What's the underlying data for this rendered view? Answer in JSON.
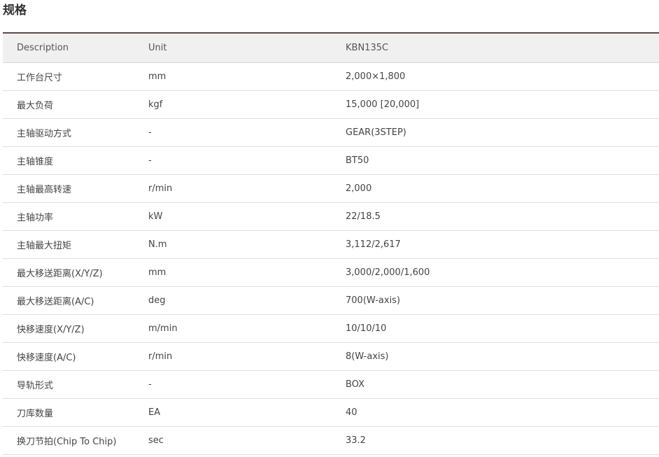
{
  "title": "规格",
  "table": {
    "headers": [
      "Description",
      "Unit",
      "KBN135C"
    ],
    "rows": [
      [
        "工作台尺寸",
        "mm",
        "2,000×1,800"
      ],
      [
        "最大负荷",
        "kgf",
        "15,000 [20,000]"
      ],
      [
        "主轴驱动方式",
        "-",
        "GEAR(3STEP)"
      ],
      [
        "主轴锥度",
        "-",
        "BT50"
      ],
      [
        "主轴最高转速",
        "r/min",
        "2,000"
      ],
      [
        "主轴功率",
        "kW",
        "22/18.5"
      ],
      [
        "主轴最大扭矩",
        "N.m",
        "3,112/2,617"
      ],
      [
        "最大移送距离(X/Y/Z)",
        "mm",
        "3,000/2,000/1,600"
      ],
      [
        "最大移送距离(A/C)",
        "deg",
        "700(W-axis)"
      ],
      [
        "快移速度(X/Y/Z)",
        "m/min",
        "10/10/10"
      ],
      [
        "快移速度(A/C)",
        "r/min",
        "8(W-axis)"
      ],
      [
        "导轨形式",
        "-",
        "BOX"
      ],
      [
        "刀库数量",
        "EA",
        "40"
      ],
      [
        "换刀节拍(Chip To Chip)",
        "sec",
        "33.2"
      ]
    ]
  }
}
